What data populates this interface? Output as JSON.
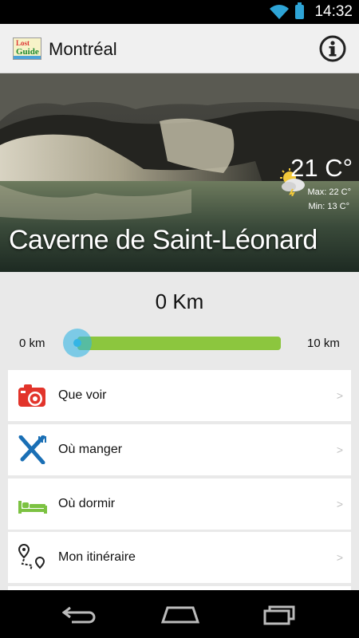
{
  "status_bar": {
    "time": "14:32"
  },
  "app_bar": {
    "logo": {
      "line1": "Lost",
      "line2": "Guide"
    },
    "title": "Montréal",
    "info_icon": "info-icon"
  },
  "hero": {
    "place_name": "Caverne de Saint-Léonard",
    "weather": {
      "icon": "partly-sunny-storm-icon",
      "temperature": "21 C°",
      "max": "Max: 22 C°",
      "min": "Min: 13 C°"
    }
  },
  "distance": {
    "value_label": "0 Km",
    "min_label": "0 km",
    "max_label": "10 km",
    "fraction": 0.0
  },
  "menu": [
    {
      "label": "Que voir",
      "icon": "camera-icon",
      "chevron": ">"
    },
    {
      "label": "Où manger",
      "icon": "fork-knife-icon",
      "chevron": ">"
    },
    {
      "label": "Où dormir",
      "icon": "bed-icon",
      "chevron": ">"
    },
    {
      "label": "Mon itinéraire",
      "icon": "route-icon",
      "chevron": ">"
    }
  ],
  "colors": {
    "accent_green": "#8cc63e",
    "accent_blue": "#33b5e5",
    "camera_red": "#e2342b",
    "fork_blue": "#1a6fb5",
    "bed_green": "#7cc242"
  }
}
